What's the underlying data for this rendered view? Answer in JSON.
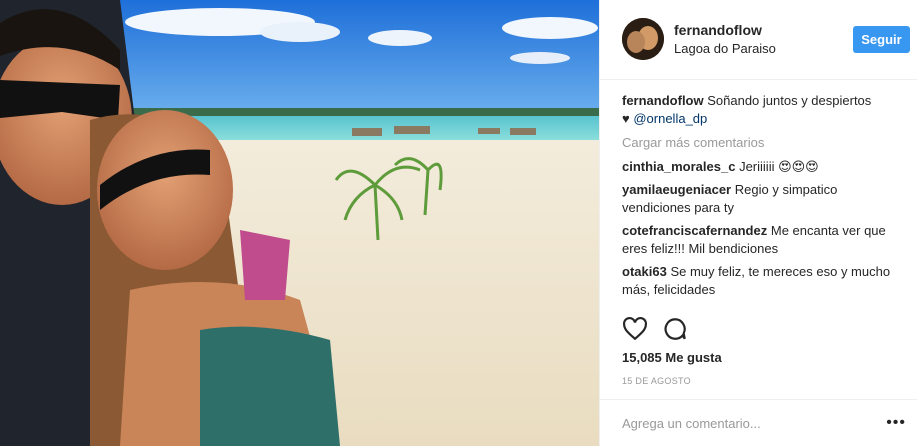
{
  "post": {
    "username": "fernandoflow",
    "location": "Lagoa do Paraiso",
    "follow_label": "Seguir",
    "caption_text": "Soñando juntos y despiertos",
    "caption_heart": "♥",
    "caption_mention": "@ornella_dp",
    "load_more": "Cargar más comentarios",
    "comments": [
      {
        "user": "cinthia_morales_c",
        "text": "Jeriiiiii 😍😍😍"
      },
      {
        "user": "yamilaeugeniacer",
        "text": "Regio y simpatico vendiciones para ty"
      },
      {
        "user": "cotefranciscafernandez",
        "text": "Me encanta ver que eres feliz!!! Mil bendiciones"
      },
      {
        "user": "otaki63",
        "text": "Se muy feliz, te mereces eso y mucho más, felicidades"
      }
    ],
    "likes": "15,085 Me gusta",
    "date": "15 DE AGOSTO",
    "add_comment_placeholder": "Agrega un comentario...",
    "menu_dots": "•••",
    "icons": {
      "like": "heart-outline-icon",
      "comment": "speech-bubble-icon",
      "menu": "more-options-icon"
    },
    "colors": {
      "follow_button": "#3897f0",
      "mention": "#003569",
      "muted": "#999999"
    }
  }
}
